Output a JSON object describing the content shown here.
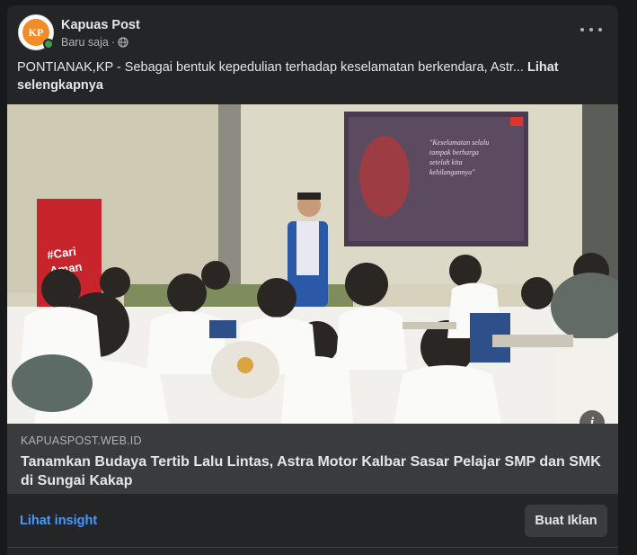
{
  "post": {
    "author": "Kapuas Post",
    "avatar_text": "KP",
    "timestamp": "Baru saja",
    "separator": "·",
    "text": "PONTIANAK,KP - Sebagai bentuk kepedulian terhadap keselamatan berkendara, Astr... ",
    "see_more": "Lihat selengkapnya"
  },
  "photo": {
    "banner_text": "#Cari Aman",
    "screen_quote": "\"Keselamatan selalu tampak berharga setelah kita kehilangannya\""
  },
  "link_preview": {
    "domain": "KAPUASPOST.WEB.ID",
    "title": "Tanamkan Budaya Tertib Lalu Lintas, Astra Motor Kalbar Sasar Pelajar SMP dan SMK di Sungai Kakap"
  },
  "actions": {
    "insight": "Lihat insight",
    "ad_button": "Buat Iklan"
  },
  "icons": {
    "more": "more-icon",
    "globe": "globe-icon",
    "info": "info-icon"
  },
  "colors": {
    "background": "#18191a",
    "card": "#242526",
    "link_preview_bg": "#3a3b3c",
    "insight_link": "#4599ff",
    "online": "#31a24c"
  }
}
